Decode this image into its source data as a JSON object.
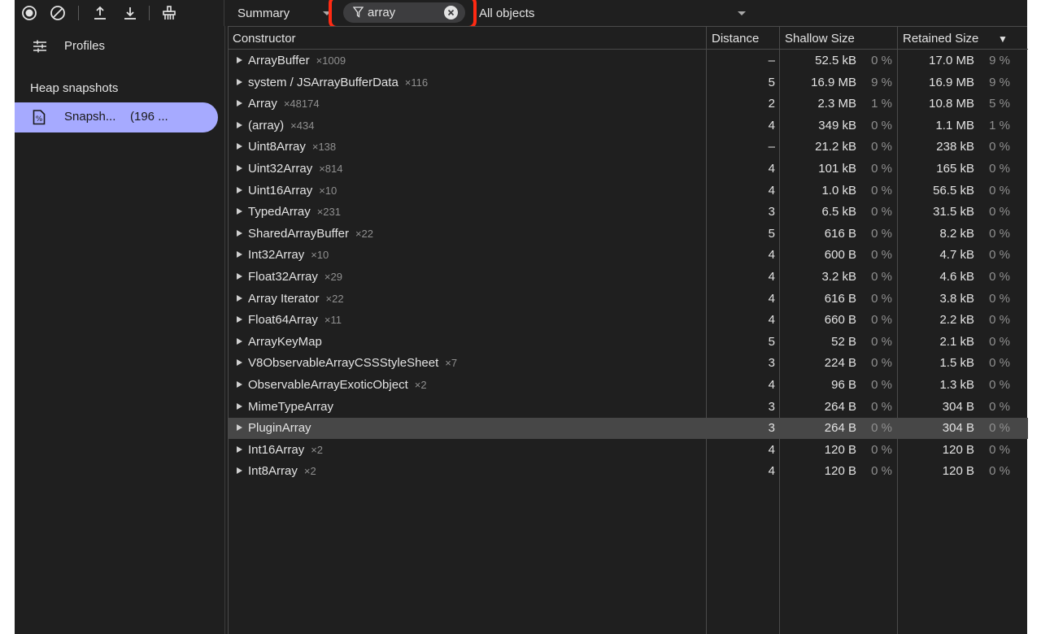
{
  "toolbar": {
    "icons": [
      "record-icon",
      "clear-icon",
      "upload-icon",
      "download-icon",
      "garbage-collect-icon"
    ],
    "view_label": "Summary",
    "filter_value": "array",
    "objects_label": "All objects"
  },
  "sidebar": {
    "profiles_label": "Profiles",
    "section_heading": "Heap snapshots",
    "snapshot_label": "Snapsh...",
    "snapshot_size": "(196 ..."
  },
  "table": {
    "columns": [
      "Constructor",
      "Distance",
      "Shallow Size",
      "Retained Size"
    ],
    "sort_indicator": "▼",
    "rows": [
      {
        "name": "ArrayBuffer",
        "count": "×1009",
        "distance": "–",
        "shallow": "52.5 kB",
        "shallow_pct": "0 %",
        "retained": "17.0 MB",
        "retained_pct": "9 %"
      },
      {
        "name": "system / JSArrayBufferData",
        "count": "×116",
        "distance": "5",
        "shallow": "16.9 MB",
        "shallow_pct": "9 %",
        "retained": "16.9 MB",
        "retained_pct": "9 %"
      },
      {
        "name": "Array",
        "count": "×48174",
        "distance": "2",
        "shallow": "2.3 MB",
        "shallow_pct": "1 %",
        "retained": "10.8 MB",
        "retained_pct": "5 %"
      },
      {
        "name": "(array)",
        "count": "×434",
        "distance": "4",
        "shallow": "349 kB",
        "shallow_pct": "0 %",
        "retained": "1.1 MB",
        "retained_pct": "1 %"
      },
      {
        "name": "Uint8Array",
        "count": "×138",
        "distance": "–",
        "shallow": "21.2 kB",
        "shallow_pct": "0 %",
        "retained": "238 kB",
        "retained_pct": "0 %"
      },
      {
        "name": "Uint32Array",
        "count": "×814",
        "distance": "4",
        "shallow": "101 kB",
        "shallow_pct": "0 %",
        "retained": "165 kB",
        "retained_pct": "0 %"
      },
      {
        "name": "Uint16Array",
        "count": "×10",
        "distance": "4",
        "shallow": "1.0 kB",
        "shallow_pct": "0 %",
        "retained": "56.5 kB",
        "retained_pct": "0 %"
      },
      {
        "name": "TypedArray",
        "count": "×231",
        "distance": "3",
        "shallow": "6.5 kB",
        "shallow_pct": "0 %",
        "retained": "31.5 kB",
        "retained_pct": "0 %"
      },
      {
        "name": "SharedArrayBuffer",
        "count": "×22",
        "distance": "5",
        "shallow": "616 B",
        "shallow_pct": "0 %",
        "retained": "8.2 kB",
        "retained_pct": "0 %"
      },
      {
        "name": "Int32Array",
        "count": "×10",
        "distance": "4",
        "shallow": "600 B",
        "shallow_pct": "0 %",
        "retained": "4.7 kB",
        "retained_pct": "0 %"
      },
      {
        "name": "Float32Array",
        "count": "×29",
        "distance": "4",
        "shallow": "3.2 kB",
        "shallow_pct": "0 %",
        "retained": "4.6 kB",
        "retained_pct": "0 %"
      },
      {
        "name": "Array Iterator",
        "count": "×22",
        "distance": "4",
        "shallow": "616 B",
        "shallow_pct": "0 %",
        "retained": "3.8 kB",
        "retained_pct": "0 %"
      },
      {
        "name": "Float64Array",
        "count": "×11",
        "distance": "4",
        "shallow": "660 B",
        "shallow_pct": "0 %",
        "retained": "2.2 kB",
        "retained_pct": "0 %"
      },
      {
        "name": "ArrayKeyMap",
        "count": "",
        "distance": "5",
        "shallow": "52 B",
        "shallow_pct": "0 %",
        "retained": "2.1 kB",
        "retained_pct": "0 %"
      },
      {
        "name": "V8ObservableArrayCSSStyleSheet",
        "count": "×7",
        "distance": "3",
        "shallow": "224 B",
        "shallow_pct": "0 %",
        "retained": "1.5 kB",
        "retained_pct": "0 %"
      },
      {
        "name": "ObservableArrayExoticObject",
        "count": "×2",
        "distance": "4",
        "shallow": "96 B",
        "shallow_pct": "0 %",
        "retained": "1.3 kB",
        "retained_pct": "0 %"
      },
      {
        "name": "MimeTypeArray",
        "count": "",
        "distance": "3",
        "shallow": "264 B",
        "shallow_pct": "0 %",
        "retained": "304 B",
        "retained_pct": "0 %"
      },
      {
        "name": "PluginArray",
        "count": "",
        "distance": "3",
        "shallow": "264 B",
        "shallow_pct": "0 %",
        "retained": "304 B",
        "retained_pct": "0 %",
        "selected": true
      },
      {
        "name": "Int16Array",
        "count": "×2",
        "distance": "4",
        "shallow": "120 B",
        "shallow_pct": "0 %",
        "retained": "120 B",
        "retained_pct": "0 %"
      },
      {
        "name": "Int8Array",
        "count": "×2",
        "distance": "4",
        "shallow": "120 B",
        "shallow_pct": "0 %",
        "retained": "120 B",
        "retained_pct": "0 %"
      }
    ]
  },
  "colors": {
    "background": "#1f1f1f",
    "selected_sidebar": "#a6aaff",
    "selected_row": "#474747",
    "highlight_outline": "#ff2a13"
  }
}
